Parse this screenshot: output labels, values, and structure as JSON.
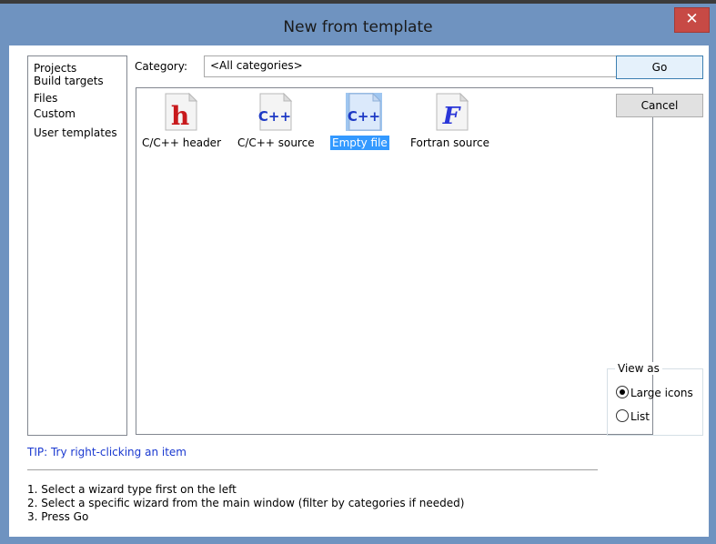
{
  "window": {
    "title": "New from template",
    "close_glyph": "✕"
  },
  "sidebar": {
    "items": [
      {
        "label": "Projects"
      },
      {
        "label": "Build targets"
      },
      {
        "label": "Files"
      },
      {
        "label": "Custom"
      },
      {
        "label": "User templates"
      }
    ]
  },
  "category": {
    "label": "Category:",
    "value": "<All categories>",
    "arrow_glyph": "⌄"
  },
  "templates": [
    {
      "label": "C/C++ header",
      "icon": "c-header-icon",
      "glyph": "h",
      "color": "#c8191c"
    },
    {
      "label": "C/C++ source",
      "icon": "cpp-source-icon",
      "glyph": "C++",
      "color": "#1d39c4"
    },
    {
      "label": "Empty file",
      "icon": "empty-file-icon",
      "glyph": "C++",
      "color": "#1d39c4",
      "selected": true
    },
    {
      "label": "Fortran source",
      "icon": "fortran-icon",
      "glyph": "F",
      "color": "#2a36d8"
    }
  ],
  "buttons": {
    "go": "Go",
    "cancel": "Cancel"
  },
  "view_as": {
    "legend": "View as",
    "large_icons": "Large icons",
    "list": "List",
    "selected": "large_icons"
  },
  "tip": "TIP: Try right-clicking an item",
  "instructions": [
    "1. Select a wizard type first on the left",
    "2. Select a specific wizard from the main window (filter by categories if needed)",
    "3. Press Go"
  ],
  "colors": {
    "frame": "#6f93c0",
    "selection": "#3399ff",
    "tip_text": "#1a39d0",
    "close_button": "#c74a45"
  }
}
